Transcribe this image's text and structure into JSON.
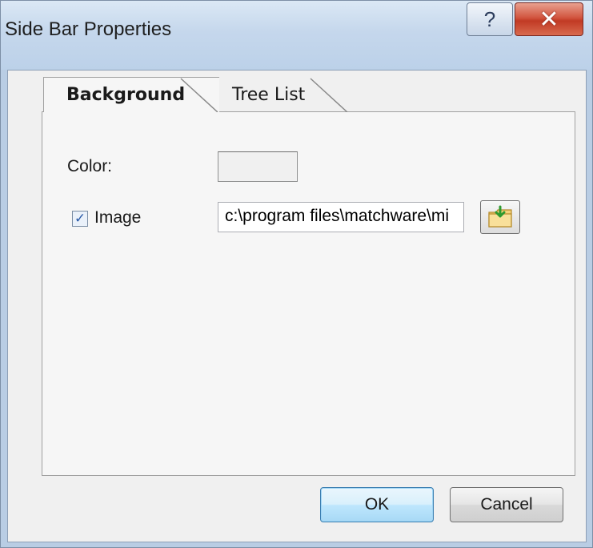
{
  "window": {
    "title": "Side Bar Properties",
    "help_glyph": "?",
    "close_glyph": "✕"
  },
  "tabs": [
    {
      "label": "Background",
      "active": true
    },
    {
      "label": "Tree List",
      "active": false
    }
  ],
  "background_tab": {
    "color_label": "Color:",
    "image_checkbox_label": "Image",
    "image_checked": true,
    "image_path_value": "c:\\program files\\matchware\\mi",
    "browse_icon": "folder-with-green-arrow-icon"
  },
  "buttons": {
    "ok_label": "OK",
    "cancel_label": "Cancel"
  },
  "colors": {
    "titlebar": "#c5d7ec",
    "close_button": "#c13a24",
    "ok_button_border": "#3c7fb1"
  }
}
